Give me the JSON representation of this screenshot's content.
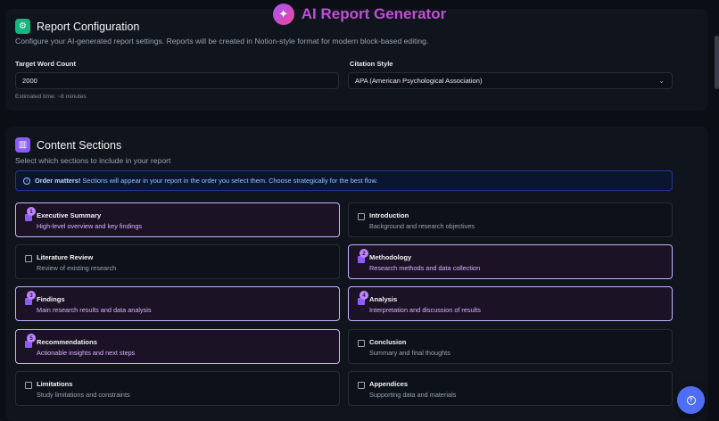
{
  "header": {
    "title": "AI Report Generator",
    "logo_icon": "sparkles-icon"
  },
  "config": {
    "title": "Report Configuration",
    "icon": "settings-icon",
    "description": "Configure your AI-generated report settings. Reports will be created in Notion-style format for modern block-based editing.",
    "word_count": {
      "label": "Target Word Count",
      "value": "2000",
      "hint": "Estimated time: ~8 minutes"
    },
    "citation": {
      "label": "Citation Style",
      "value": "APA (American Psychological Association)"
    }
  },
  "sections": {
    "title": "Content Sections",
    "icon": "chart-icon",
    "description": "Select which sections to include in your report",
    "notice_bold": "Order matters!",
    "notice_text": "Sections will appear in your report in the order you select them. Choose strategically for the best flow.",
    "items": [
      {
        "title": "Executive Summary",
        "subtitle": "High-level overview and key findings",
        "selected": true,
        "order": "1"
      },
      {
        "title": "Introduction",
        "subtitle": "Background and research objectives",
        "selected": false,
        "order": ""
      },
      {
        "title": "Literature Review",
        "subtitle": "Review of existing research",
        "selected": false,
        "order": ""
      },
      {
        "title": "Methodology",
        "subtitle": "Research methods and data collection",
        "selected": true,
        "order": "2"
      },
      {
        "title": "Findings",
        "subtitle": "Main research results and data analysis",
        "selected": true,
        "order": "3"
      },
      {
        "title": "Analysis",
        "subtitle": "Interpretation and discussion of results",
        "selected": true,
        "order": "4"
      },
      {
        "title": "Recommendations",
        "subtitle": "Actionable insights and next steps",
        "selected": true,
        "order": "5"
      },
      {
        "title": "Conclusion",
        "subtitle": "Summary and final thoughts",
        "selected": false,
        "order": ""
      },
      {
        "title": "Limitations",
        "subtitle": "Study limitations and constraints",
        "selected": false,
        "order": ""
      },
      {
        "title": "Appendices",
        "subtitle": "Supporting data and materials",
        "selected": false,
        "order": ""
      }
    ]
  },
  "help_button": {
    "icon": "help-icon"
  },
  "colors": {
    "accent": "#8b5cf6",
    "brand": "#c14fd8",
    "selected_border": "#c4b5fd",
    "fab": "#4f6ef7"
  }
}
